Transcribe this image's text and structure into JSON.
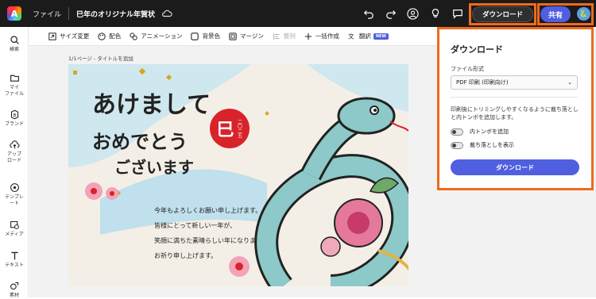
{
  "topbar": {
    "logo_letter": "A",
    "file_menu": "ファイル",
    "document_title": "巳年のオリジナル年賀状",
    "download_label": "ダウンロード",
    "share_label": "共有",
    "icons": [
      "undo-icon",
      "redo-icon",
      "user-icon",
      "lightbulb-icon",
      "comment-icon",
      "flask-icon"
    ]
  },
  "sidebar": {
    "items": [
      {
        "label": "検索",
        "icon": "search-icon"
      },
      {
        "label": "マイ\nファイル",
        "icon": "folder-icon"
      },
      {
        "label": "ブランド",
        "icon": "brand-icon"
      },
      {
        "label": "アップ\nロード",
        "icon": "upload-icon"
      },
      {
        "label": "テンプレ\nート",
        "icon": "template-icon"
      },
      {
        "label": "メディア",
        "icon": "media-icon"
      },
      {
        "label": "テキスト",
        "icon": "text-icon"
      },
      {
        "label": "素材",
        "icon": "elements-icon"
      }
    ]
  },
  "toolbar": {
    "items": [
      {
        "label": "サイズ変更",
        "icon": "resize-icon",
        "disabled": false
      },
      {
        "label": "配色",
        "icon": "palette-icon",
        "disabled": false
      },
      {
        "label": "アニメーション",
        "icon": "animation-icon",
        "disabled": false
      },
      {
        "label": "背景色",
        "icon": "background-icon",
        "disabled": false
      },
      {
        "label": "マージン",
        "icon": "margin-icon",
        "disabled": false
      },
      {
        "label": "整列",
        "icon": "align-icon",
        "disabled": true
      },
      {
        "label": "一括作成",
        "icon": "bulk-create-icon",
        "disabled": false
      },
      {
        "label": "翻訳",
        "icon": "translate-icon",
        "disabled": false
      }
    ],
    "new_badge": "NEW"
  },
  "page_label": "1/1ページ - タイトルを追加",
  "card": {
    "greeting_lines": [
      "あけまして",
      "おめでとう",
      "ございます"
    ],
    "seal_char": "巳",
    "seal_small": "二〇二五",
    "message_lines": [
      "今年もよろしくお願い申し上げます。",
      "皆様にとって新しい一年が、",
      "笑顔に満ちた素晴らしい年になりますよう",
      "お祈り申し上げます。"
    ]
  },
  "download_panel": {
    "title": "ダウンロード",
    "format_label": "ファイル形式",
    "format_value": "PDF 印刷 (印刷向け)",
    "description": "印刷後にトリミングしやすくなるように裁ち落としと内トンボを追加します。",
    "toggles": [
      {
        "label": "内トンボを追加",
        "on": false
      },
      {
        "label": "裁ち落としを表示",
        "on": false
      }
    ],
    "button_label": "ダウンロード"
  },
  "colors": {
    "topbar": "#1b1b1b",
    "accent": "#4f5fe0",
    "highlight": "#f06a1c",
    "seal_red": "#d8232a",
    "snake_teal": "#8cc9c8"
  }
}
